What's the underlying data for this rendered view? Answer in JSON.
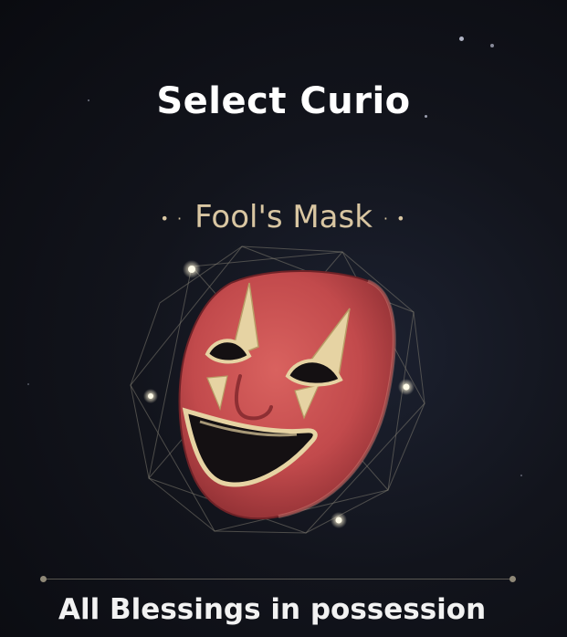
{
  "screen": {
    "title": "Select Curio"
  },
  "curio": {
    "name": "Fool's Mask",
    "icon": "fools-mask-icon"
  },
  "section": {
    "label": "All Blessings in possession"
  },
  "colors": {
    "title": "#ffffff",
    "curio_name": "#d9c6a2",
    "mask_red": "#c24a4c",
    "mask_gold": "#e6d3a3",
    "background": "#12141c"
  }
}
